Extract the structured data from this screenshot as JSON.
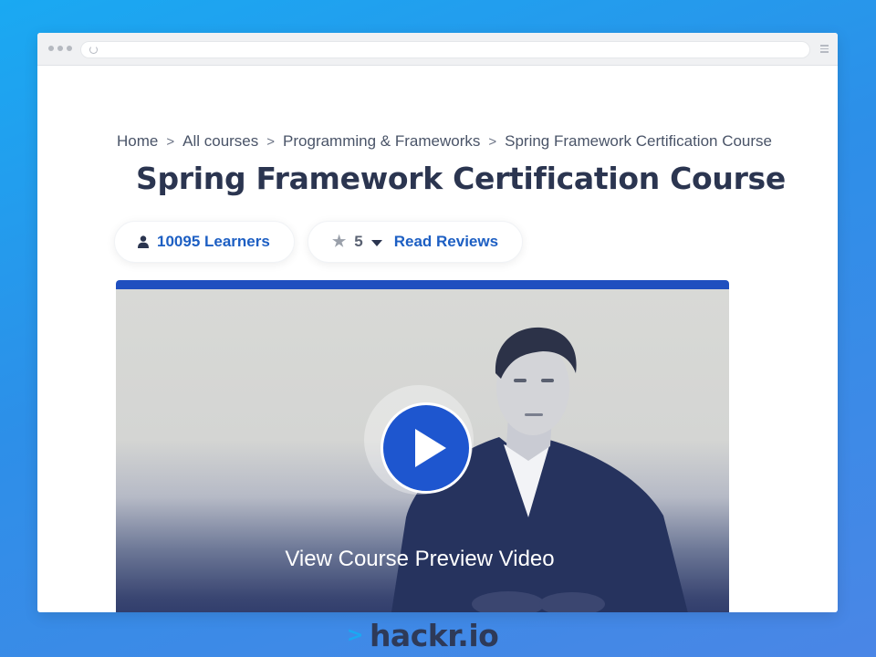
{
  "breadcrumb": {
    "items": [
      "Home",
      "All courses",
      "Programming & Frameworks",
      "Spring Framework Certification Course"
    ],
    "separator": ">"
  },
  "page_title": "Spring Framework Certification Course",
  "stats": {
    "learners_label": "10095 Learners",
    "rating_value": "5",
    "reviews_label": "Read Reviews"
  },
  "video": {
    "caption": "View Course Preview Video"
  },
  "brand": {
    "logo_text": "hackr.io"
  },
  "icons": {
    "learners": "user-icon",
    "rating": "star-icon",
    "dropdown": "caret-down-icon",
    "play": "play-icon",
    "reload": "reload-icon",
    "menu": "hamburger-icon"
  },
  "colors": {
    "accent_blue": "#1d5fc3",
    "title_navy": "#2b3550",
    "background_blue": "#2d8fe8",
    "play_blue": "#1e56cf"
  }
}
